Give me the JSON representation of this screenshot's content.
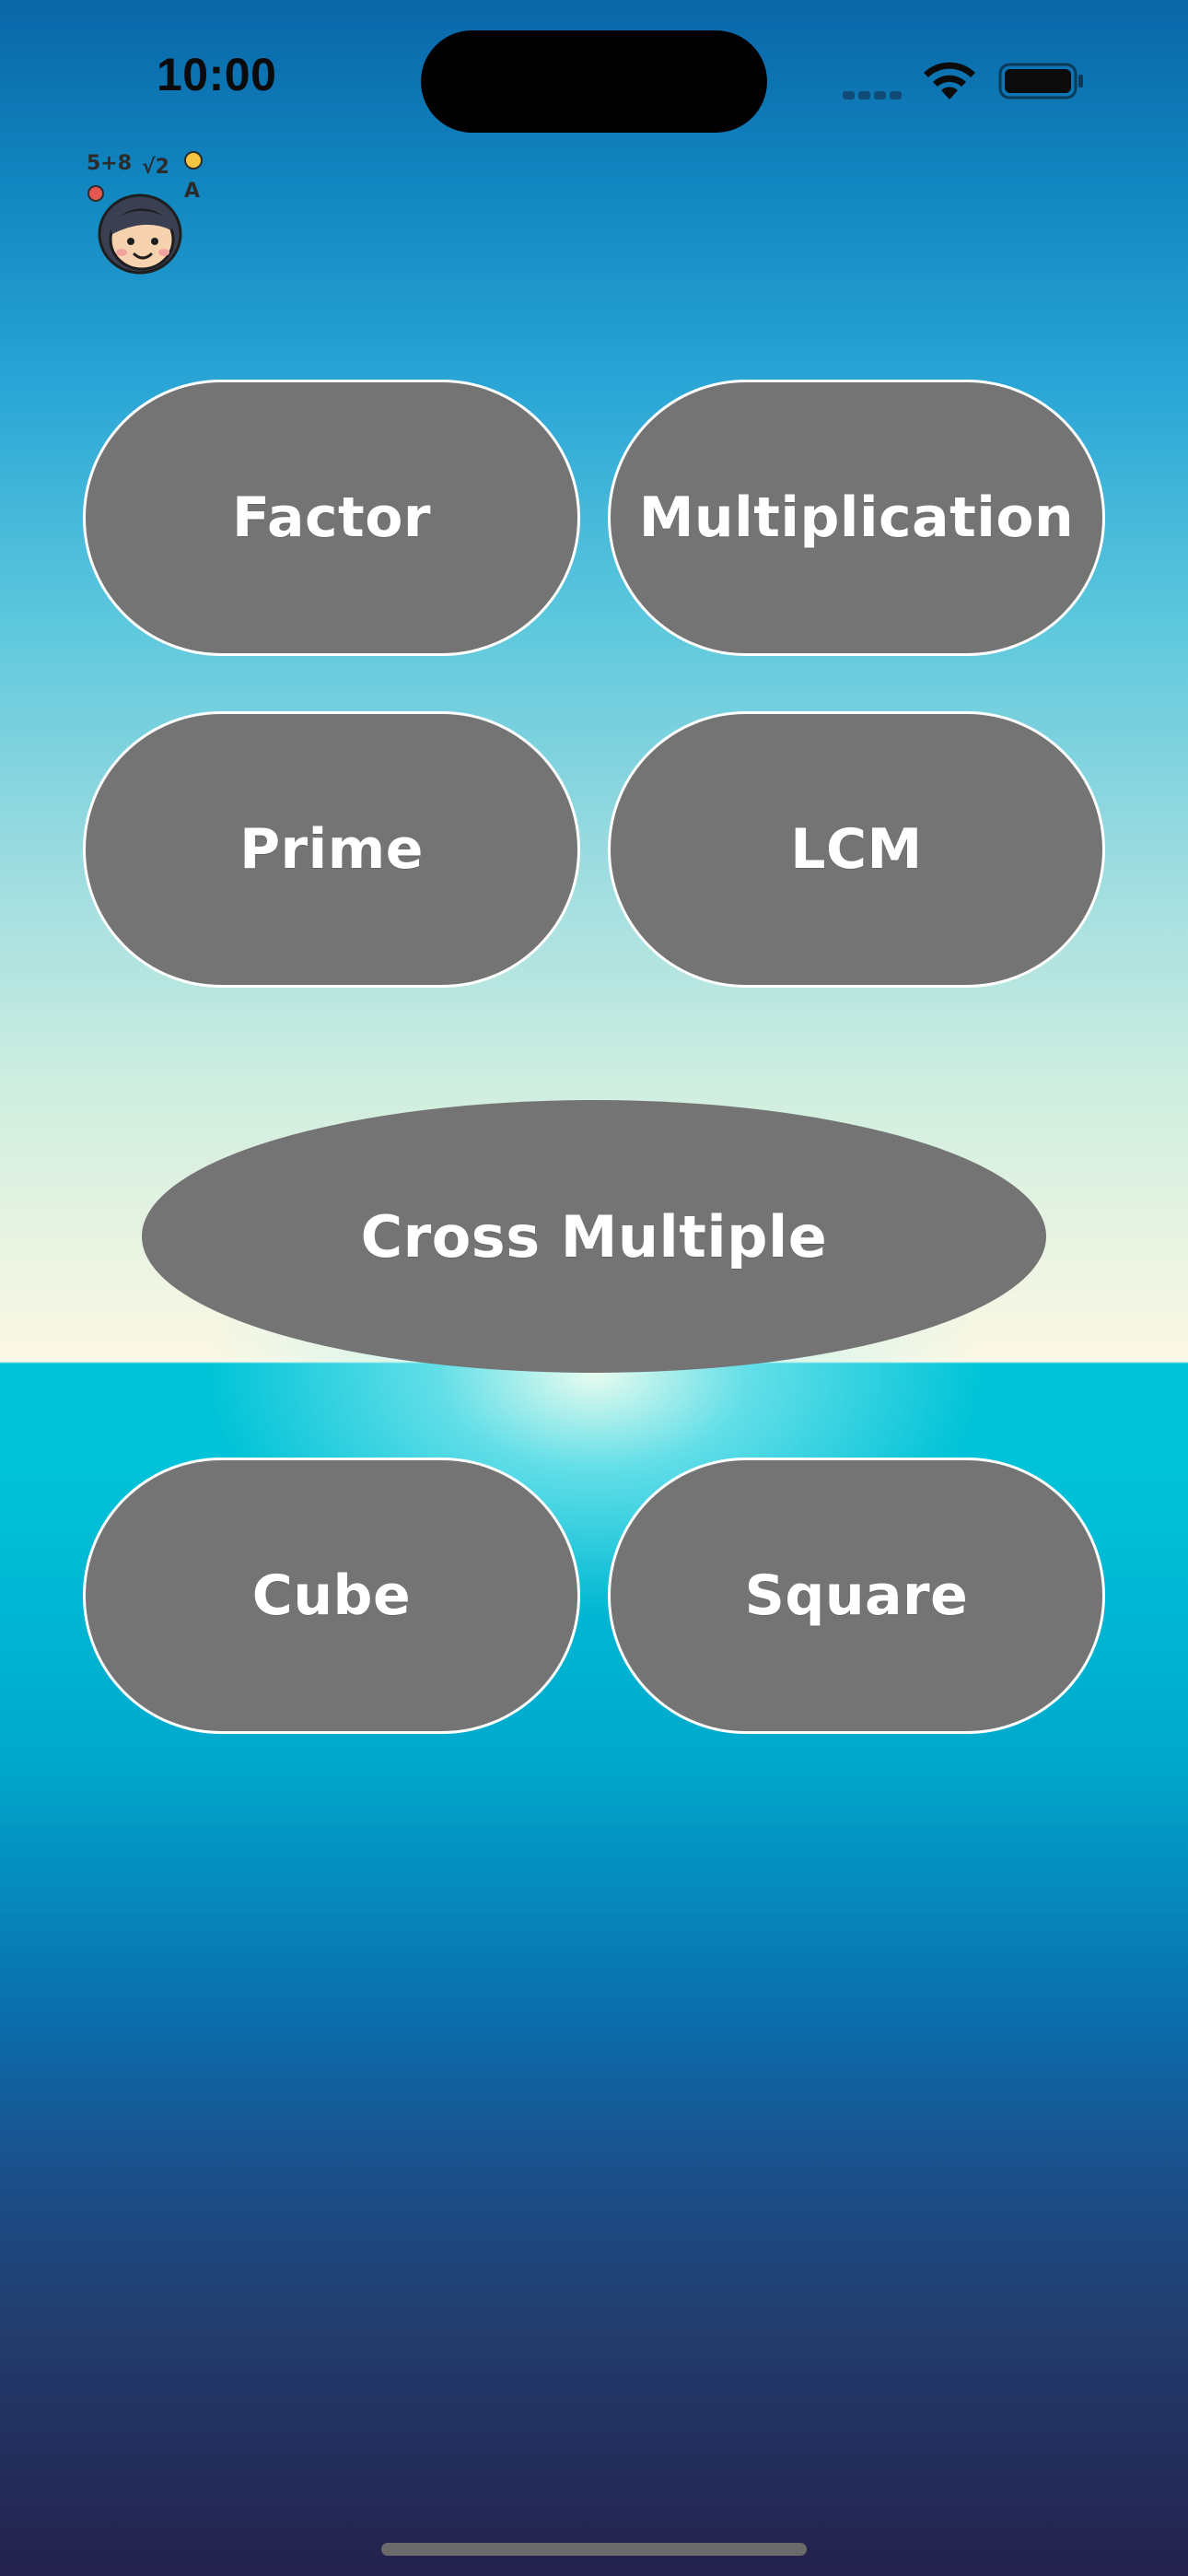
{
  "status_bar": {
    "time": "10:00",
    "icons": [
      "cellular-icon",
      "wifi-icon",
      "battery-icon"
    ]
  },
  "header": {
    "avatar_icon": "math-kid-avatar-icon",
    "avatar_symbols": [
      "5+8",
      "√2",
      "A"
    ]
  },
  "menu": {
    "factor": "Factor",
    "multiplication": "Multiplication",
    "prime": "Prime",
    "lcm": "LCM",
    "cross_multiple": "Cross Multiple",
    "cube": "Cube",
    "square": "Square"
  },
  "colors": {
    "button_fill": "#747474",
    "button_border": "#ffffff",
    "button_text": "#ffffff"
  }
}
